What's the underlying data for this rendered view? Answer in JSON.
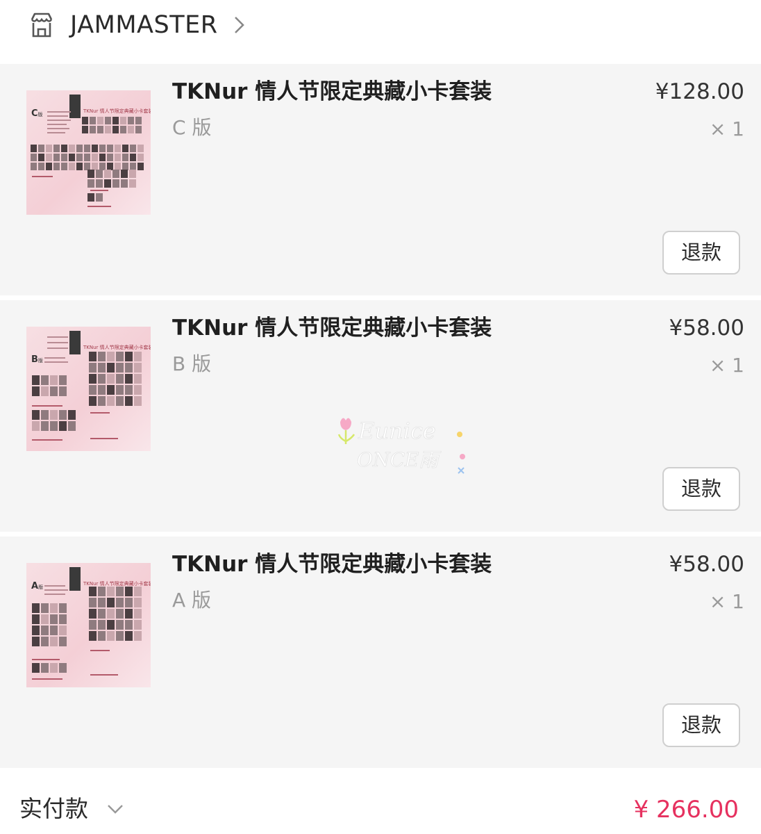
{
  "store": {
    "icon": "store-icon",
    "name": "JAMMASTER",
    "chevron": "chevron-right-icon"
  },
  "items": [
    {
      "thumb_version": "C",
      "thumb_version_suffix": "版",
      "title": "TKNur 情人节限定典藏小卡套装",
      "variant": "C 版",
      "price": "¥128.00",
      "qty": "× 1",
      "refund_label": "退款"
    },
    {
      "thumb_version": "B",
      "thumb_version_suffix": "版",
      "title": "TKNur 情人节限定典藏小卡套装",
      "variant": "B 版",
      "price": "¥58.00",
      "qty": "× 1",
      "refund_label": "退款"
    },
    {
      "thumb_version": "A",
      "thumb_version_suffix": "版",
      "title": "TKNur 情人节限定典藏小卡套装",
      "variant": "A 版",
      "price": "¥58.00",
      "qty": "× 1",
      "refund_label": "退款"
    }
  ],
  "thumb_header": "TKNur 情人节限定典藏小卡套装",
  "watermark": {
    "line1": "Eunice",
    "line2": "ONCE雨"
  },
  "total": {
    "label": "实付款",
    "chevron": "chevron-down-icon",
    "amount": "¥ 266.00"
  },
  "colors": {
    "accent": "#e6315f",
    "card_bg": "#f5f5f5",
    "muted_text": "#9a9a9a"
  }
}
